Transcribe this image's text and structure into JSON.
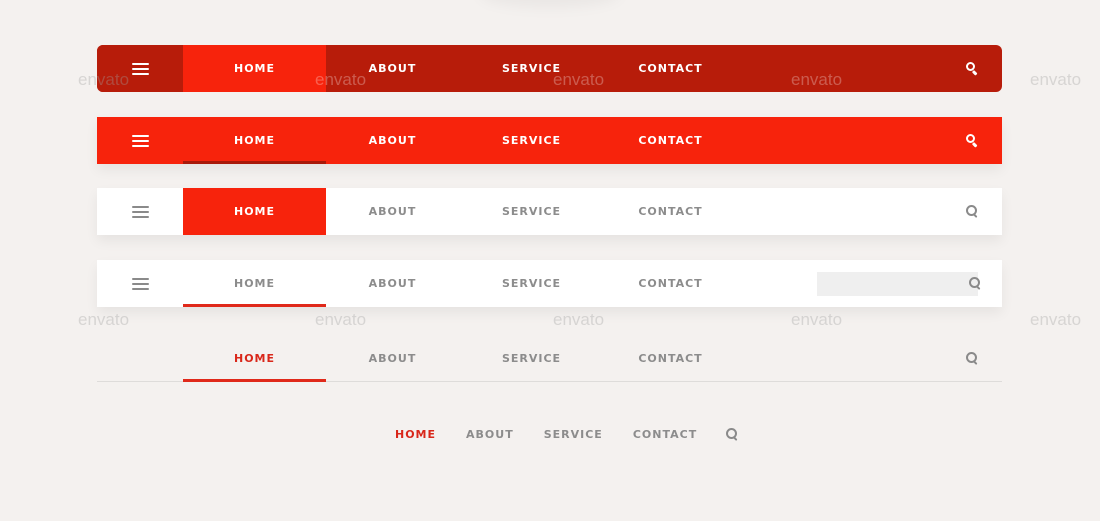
{
  "colors": {
    "dark_red": "#b71c0a",
    "bright_red": "#f7230c",
    "active_text_red": "#d9271a",
    "gray_text": "#8c8c8c",
    "background": "#f4f1ef",
    "white": "#ffffff"
  },
  "icons": {
    "menu": "hamburger-menu-icon",
    "search": "search-magnifier-icon"
  },
  "navbars": [
    {
      "style": "dark-red-rounded",
      "items": [
        "HOME",
        "ABOUT",
        "SERVICE",
        "CONTACT"
      ],
      "active": "HOME"
    },
    {
      "style": "bright-red-underline",
      "items": [
        "HOME",
        "ABOUT",
        "SERVICE",
        "CONTACT"
      ],
      "active": "HOME"
    },
    {
      "style": "white-red-block",
      "items": [
        "HOME",
        "ABOUT",
        "SERVICE",
        "CONTACT"
      ],
      "active": "HOME"
    },
    {
      "style": "white-search-field",
      "items": [
        "HOME",
        "ABOUT",
        "SERVICE",
        "CONTACT"
      ],
      "active": "HOME",
      "search_placeholder": ""
    },
    {
      "style": "transparent-underline",
      "items": [
        "HOME",
        "ABOUT",
        "SERVICE",
        "CONTACT"
      ],
      "active": "HOME"
    },
    {
      "style": "minimal-centered",
      "items": [
        "HOME",
        "ABOUT",
        "SERVICE",
        "CONTACT"
      ],
      "active": "HOME"
    }
  ],
  "watermark": "envato"
}
